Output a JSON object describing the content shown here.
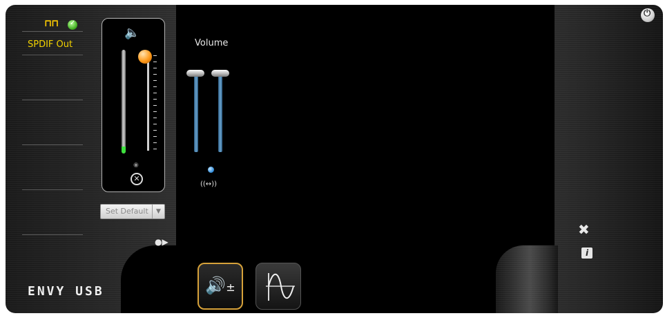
{
  "device": {
    "name": "SPDIF Out",
    "format_icon": "digital-signal-icon",
    "status_icon": "ok-check-icon",
    "status_color": "#3aa81a"
  },
  "master": {
    "speaker_icon": "speaker-icon",
    "mute_icon": "mute-icon",
    "meter_fill_color": "#3de03d",
    "knob_color": "#ff9a1a",
    "level": 1.0,
    "meter_level": 0.07
  },
  "set_default": {
    "label": "Set Default",
    "arrow": "▼"
  },
  "more_button": {
    "glyph": "●▶"
  },
  "brand": {
    "text": "ENVY USB"
  },
  "volume": {
    "label": "Volume",
    "link_label": "((↔))",
    "channels": [
      {
        "level": 1.0
      },
      {
        "level": 1.0
      }
    ],
    "bar_color": "#6aa4cf"
  },
  "tabs": [
    {
      "name": "tab-volume",
      "icon": "speaker-plus-minus-icon",
      "glyph": "🔊±",
      "active": true
    },
    {
      "name": "tab-equalizer",
      "icon": "waveform-icon",
      "active": false
    }
  ],
  "right": {
    "power_glyph": "⏻",
    "tools_glyph": "✖",
    "info_glyph": "i"
  }
}
